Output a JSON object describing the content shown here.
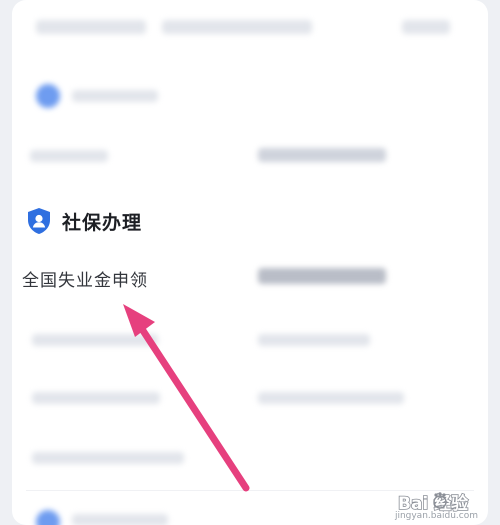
{
  "section": {
    "title": "社保办理",
    "icon": "shield-user-icon"
  },
  "service_item": {
    "label": "全国失业金申领"
  },
  "watermark": {
    "brand_text": "Bai 经验",
    "url": "jingyan.baidu.com"
  },
  "colors": {
    "accent": "#2f6fe0",
    "arrow": "#e6407e",
    "brand": "#ee3344"
  }
}
